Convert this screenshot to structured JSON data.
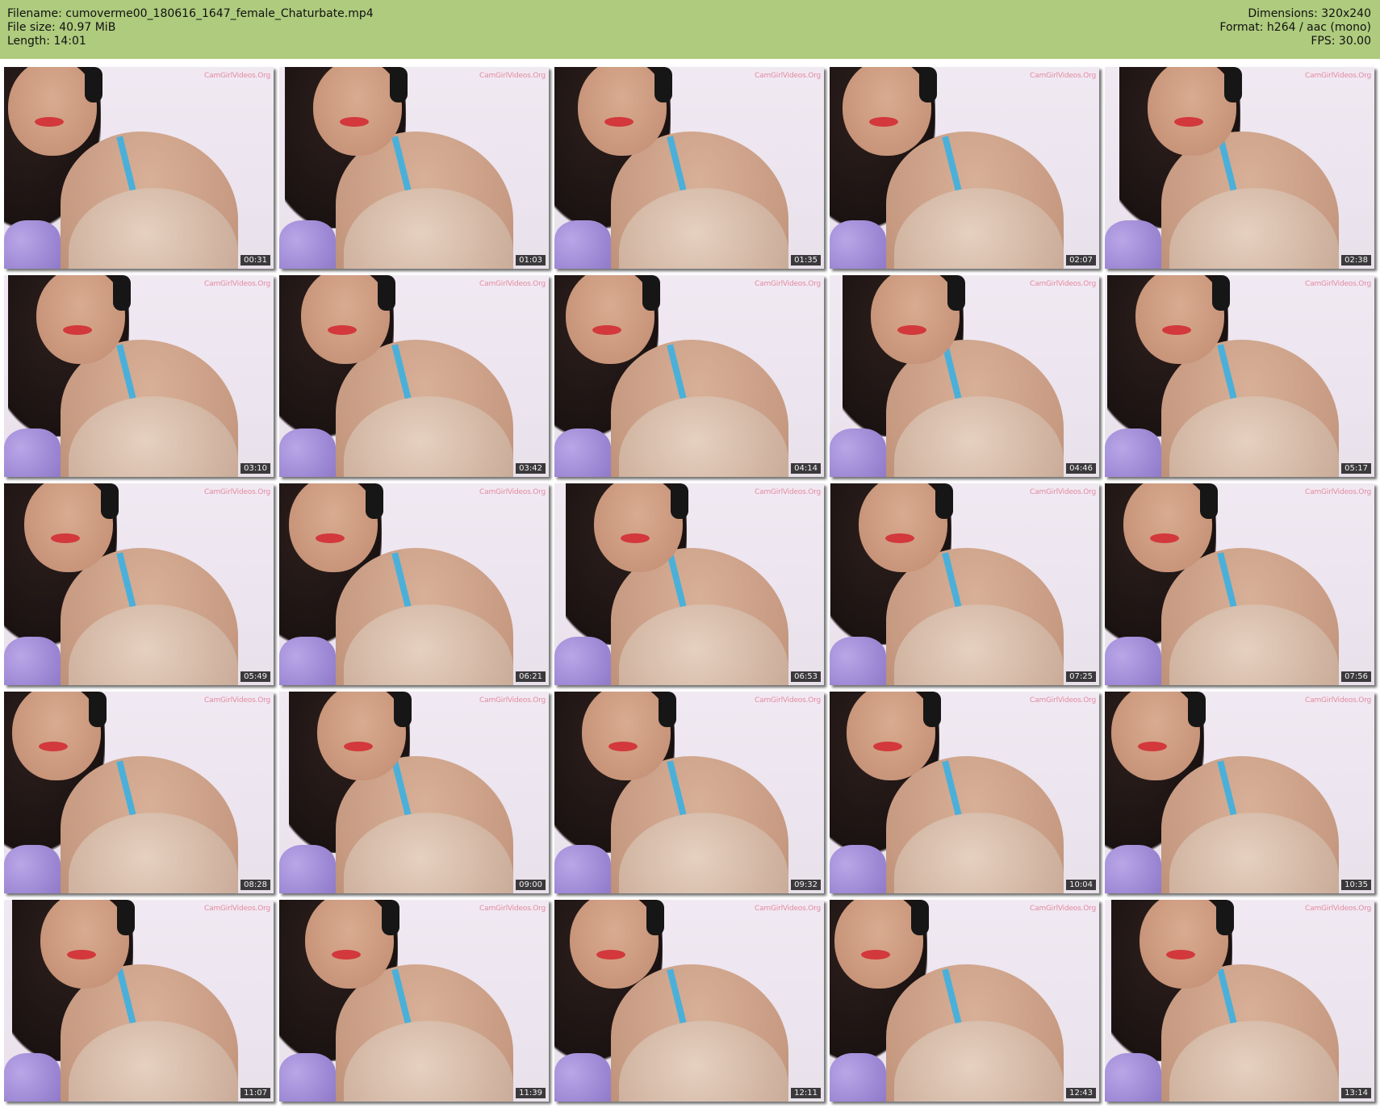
{
  "header": {
    "filename": "Filename: cumoverme00_180616_1647_female_Chaturbate.mp4",
    "filesize": "File size: 40.97 MiB",
    "length": "Length: 14:01",
    "dimensions": "Dimensions: 320x240",
    "format": "Format: h264 / aac (mono)",
    "fps": "FPS: 30.00",
    "background_color": "#aecb7e"
  },
  "watermark_text": "CamGirlVideos.Org",
  "thumbnails": [
    {
      "timestamp": "00:31"
    },
    {
      "timestamp": "01:03"
    },
    {
      "timestamp": "01:35"
    },
    {
      "timestamp": "02:07"
    },
    {
      "timestamp": "02:38"
    },
    {
      "timestamp": "03:10"
    },
    {
      "timestamp": "03:42"
    },
    {
      "timestamp": "04:14"
    },
    {
      "timestamp": "04:46"
    },
    {
      "timestamp": "05:17"
    },
    {
      "timestamp": "05:49"
    },
    {
      "timestamp": "06:21"
    },
    {
      "timestamp": "06:53"
    },
    {
      "timestamp": "07:25"
    },
    {
      "timestamp": "07:56"
    },
    {
      "timestamp": "08:28"
    },
    {
      "timestamp": "09:00"
    },
    {
      "timestamp": "09:32"
    },
    {
      "timestamp": "10:04"
    },
    {
      "timestamp": "10:35"
    },
    {
      "timestamp": "11:07"
    },
    {
      "timestamp": "11:39"
    },
    {
      "timestamp": "12:11"
    },
    {
      "timestamp": "12:43"
    },
    {
      "timestamp": "13:14"
    }
  ]
}
